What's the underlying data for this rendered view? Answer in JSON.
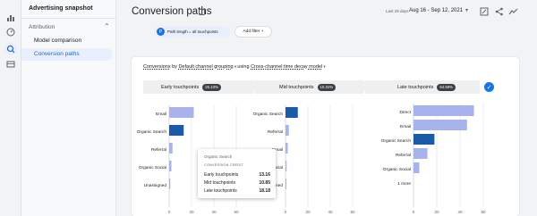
{
  "sidebar": {
    "title": "Advertising snapshot",
    "section": "Attribution",
    "items": [
      {
        "label": "Model comparison",
        "active": false
      },
      {
        "label": "Conversion paths",
        "active": true
      }
    ]
  },
  "header": {
    "title": "Conversion paths",
    "date_label": "Last 28 days",
    "date_range": "Aug 16 - Sep 12, 2021"
  },
  "filters": {
    "chip_badge": "P",
    "chip_label": "Path length = all touchpoints",
    "add_filter": "Add filter"
  },
  "card": {
    "metric": "Conversions",
    "by": "by",
    "dimension": "Default channel grouping",
    "using": "using",
    "model": "Cross-channel time decay model",
    "segments": [
      {
        "label": "Early touchpoints",
        "pct": "25.10%"
      },
      {
        "label": "Mid touchpoints",
        "pct": "10.31%"
      },
      {
        "label": "Late touchpoints",
        "pct": "64.59%"
      }
    ]
  },
  "chart_data": [
    {
      "type": "bar",
      "orientation": "horizontal",
      "categories": [
        "Email",
        "Organic Search",
        "Referral",
        "Organic Social",
        "Unassigned"
      ],
      "values": [
        22,
        13,
        3,
        2,
        1
      ],
      "xlim": [
        0,
        60
      ],
      "xticks": [
        "0",
        "20",
        "40",
        "60"
      ],
      "highlighted": "Organic Search"
    },
    {
      "type": "bar",
      "orientation": "horizontal",
      "categories": [
        "Organic Search",
        "Referral",
        "Email",
        "Organic Social",
        "Unassigned"
      ],
      "values": [
        11,
        3,
        2,
        1,
        0.5
      ],
      "xlim": [
        0,
        60
      ],
      "xticks": [
        "0",
        "20",
        "40",
        "60"
      ],
      "highlighted": "Organic Search"
    },
    {
      "type": "bar",
      "orientation": "horizontal",
      "categories": [
        "Direct",
        "Email",
        "Organic Search",
        "Referral",
        "Organic Social",
        "1 more"
      ],
      "values": [
        52,
        46,
        18,
        12,
        5,
        0
      ],
      "xlim": [
        0,
        60
      ],
      "xticks": [
        "0",
        "20",
        "40",
        "60"
      ],
      "highlighted": "Organic Search"
    }
  ],
  "tooltip": {
    "title": "Organic Search",
    "subtitle": "CONVERSION CREDIT",
    "rows": [
      {
        "label": "Early touchpoints",
        "value": "13.16"
      },
      {
        "label": "Mid touchpoints",
        "value": "10.85"
      },
      {
        "label": "Late touchpoints",
        "value": "18.18"
      }
    ]
  },
  "colors": {
    "bar": "#a8b3ee",
    "bar_highlight": "#1a5aa6",
    "accent": "#1a73e8"
  }
}
